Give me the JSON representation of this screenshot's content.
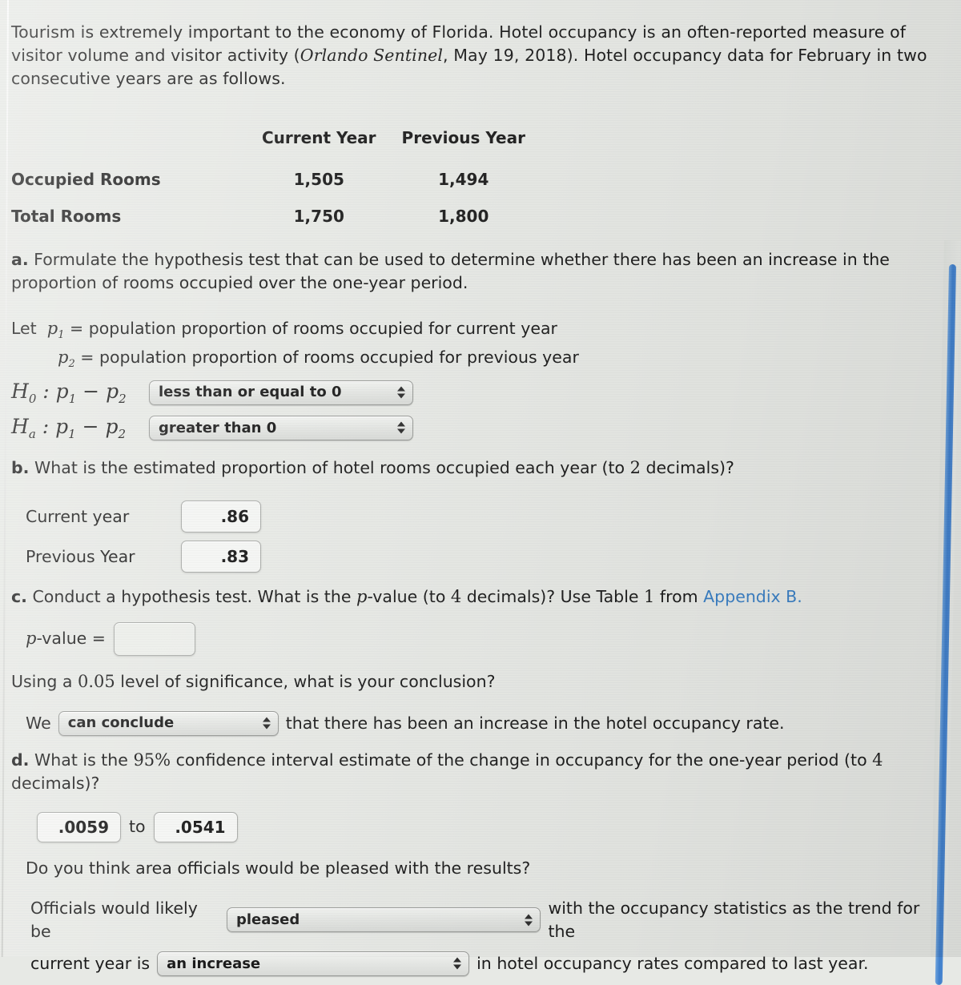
{
  "intro": {
    "part1": "Tourism is extremely important to the economy of Florida. Hotel occupancy is an often-reported measure of visitor volume and visitor activity (",
    "source_italic": "Orlando Sentinel",
    "part2": ", May 19, 2018). Hotel occupancy data for February in two consecutive years are as follows."
  },
  "table": {
    "headers": [
      "",
      "Current Year",
      "Previous Year"
    ],
    "rows": [
      {
        "label": "Occupied Rooms",
        "current": "1,505",
        "previous": "1,494"
      },
      {
        "label": "Total Rooms",
        "current": "1,750",
        "previous": "1,800"
      }
    ]
  },
  "part_a": {
    "marker": "a.",
    "text": "Formulate the hypothesis test that can be used to determine whether there has been an increase in the proportion of rooms occupied over the one-year period.",
    "let_word": "Let",
    "p1_def": "= population proportion of rooms occupied for current year",
    "p2_def": "= population proportion of rooms occupied for previous year",
    "h0_label": "H0 : p1 − p2",
    "ha_label": "Ha : p1 − p2",
    "h0_value": "less than or equal to 0",
    "ha_value": "greater than 0"
  },
  "part_b": {
    "marker": "b.",
    "text_before": "What is the estimated proportion of hotel rooms occupied each year (to ",
    "decimals": "2",
    "text_after": " decimals)?",
    "current_label": "Current year",
    "current_value": ".86",
    "previous_label": "Previous Year",
    "previous_value": ".83"
  },
  "part_c": {
    "marker": "c.",
    "text_1": "Conduct a hypothesis test. What is the ",
    "p_italic": "p",
    "text_2": "-value (to ",
    "decimals": "4",
    "text_3": " decimals)? Use Table ",
    "table_num": "1",
    "text_4": " from ",
    "link_text": "Appendix B.",
    "pvalue_label": "-value =",
    "pvalue_value": "",
    "significance_before": "Using a ",
    "significance_level": "0.05",
    "significance_after": " level of significance, what is your conclusion?",
    "we_word": "We",
    "conclusion_value": "can conclude",
    "conclusion_after": "that there has been an increase in the hotel occupancy rate."
  },
  "part_d": {
    "marker": "d.",
    "text_before": "What is the ",
    "confidence_level": "95%",
    "text_middle": " confidence interval estimate of the change in occupancy for the one-year period (to ",
    "decimals": "4",
    "text_after": " decimals)?",
    "ci_lower": ".0059",
    "ci_to": "to",
    "ci_upper": ".0541",
    "question": "Do you think area officials would be pleased with the results?",
    "officials_pre": "Officials would likely be",
    "officials_value": "pleased",
    "officials_post": "with the occupancy statistics as the trend for the",
    "trend_pre": "current year is",
    "trend_value": "an increase",
    "trend_post": "in hotel occupancy rates compared to last year."
  },
  "colors": {
    "background": "#e7e9e5",
    "text": "#1c1c1c",
    "link": "#3a7fc4",
    "scrollbar": "#3f7fcc"
  }
}
